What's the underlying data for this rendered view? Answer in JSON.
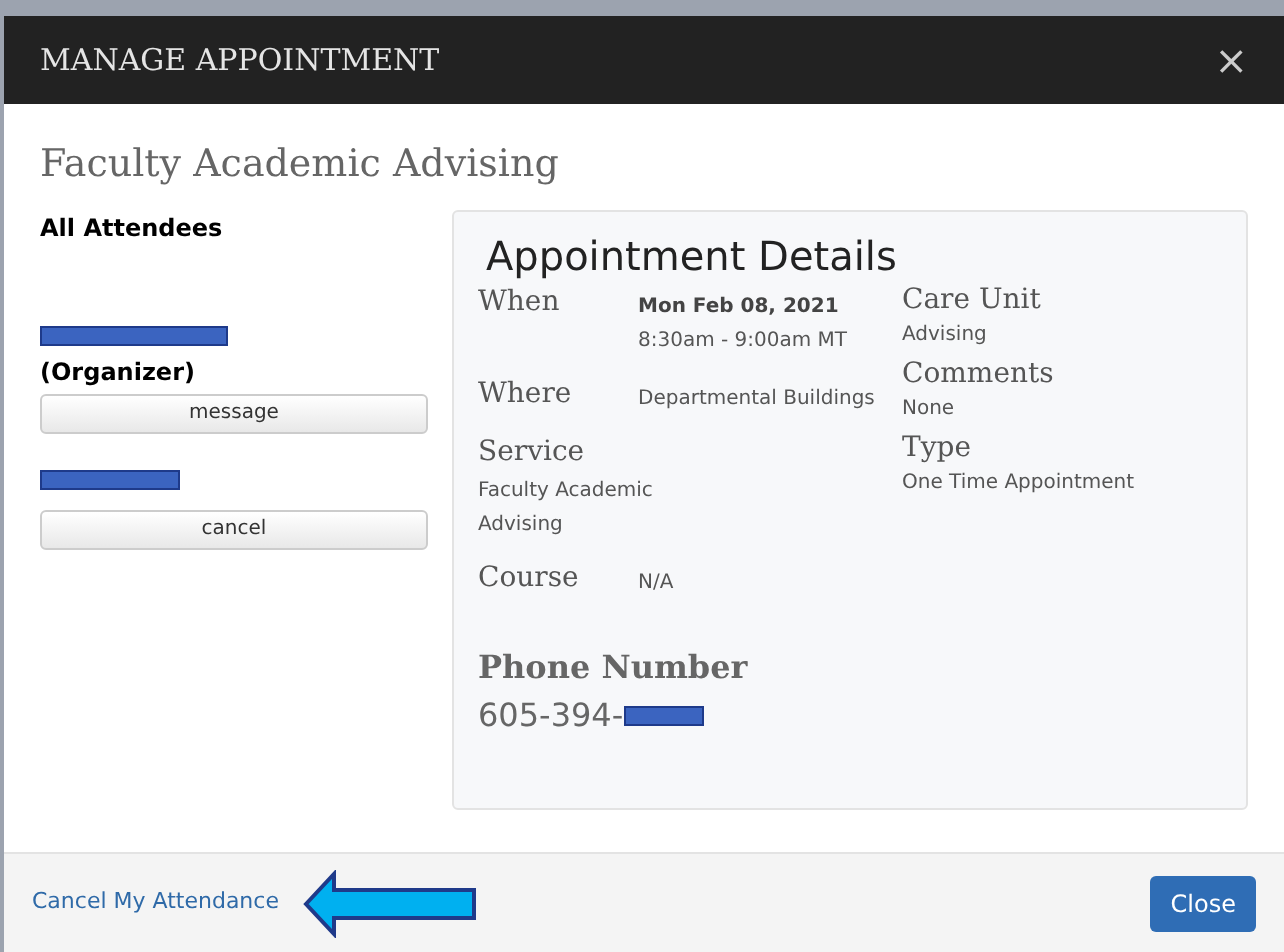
{
  "window": {
    "title": "MANAGE APPOINTMENT",
    "close": "×"
  },
  "heading": "Faculty Academic Advising",
  "attendees": {
    "title": "All Attendees",
    "people": [
      {
        "role": "(Organizer)",
        "button": "message"
      },
      {
        "button": "cancel"
      }
    ]
  },
  "details": {
    "title": "Appointment Details",
    "left": [
      {
        "label": "When",
        "lines": [
          "Mon Feb 08, 2021",
          "8:30am - 9:00am MT"
        ],
        "kind": "inline"
      },
      {
        "label": "Where",
        "lines": [
          "Departmental Buildings"
        ],
        "kind": "inline"
      },
      {
        "label": "Service",
        "lines": [
          "Faculty Academic",
          "Advising"
        ],
        "kind": "stacked"
      },
      {
        "label": "Course",
        "lines": [
          "N/A"
        ],
        "kind": "inline"
      }
    ],
    "right": [
      {
        "label": "Care Unit",
        "lines": [
          "Advising"
        ]
      },
      {
        "label": "Comments",
        "lines": [
          "None"
        ]
      },
      {
        "label": "Type",
        "lines": [
          "One Time Appointment"
        ]
      }
    ],
    "phone_label": "Phone Number",
    "phone": "605-394-"
  },
  "footer": {
    "link": "Cancel My Attendance",
    "button": "Close"
  }
}
